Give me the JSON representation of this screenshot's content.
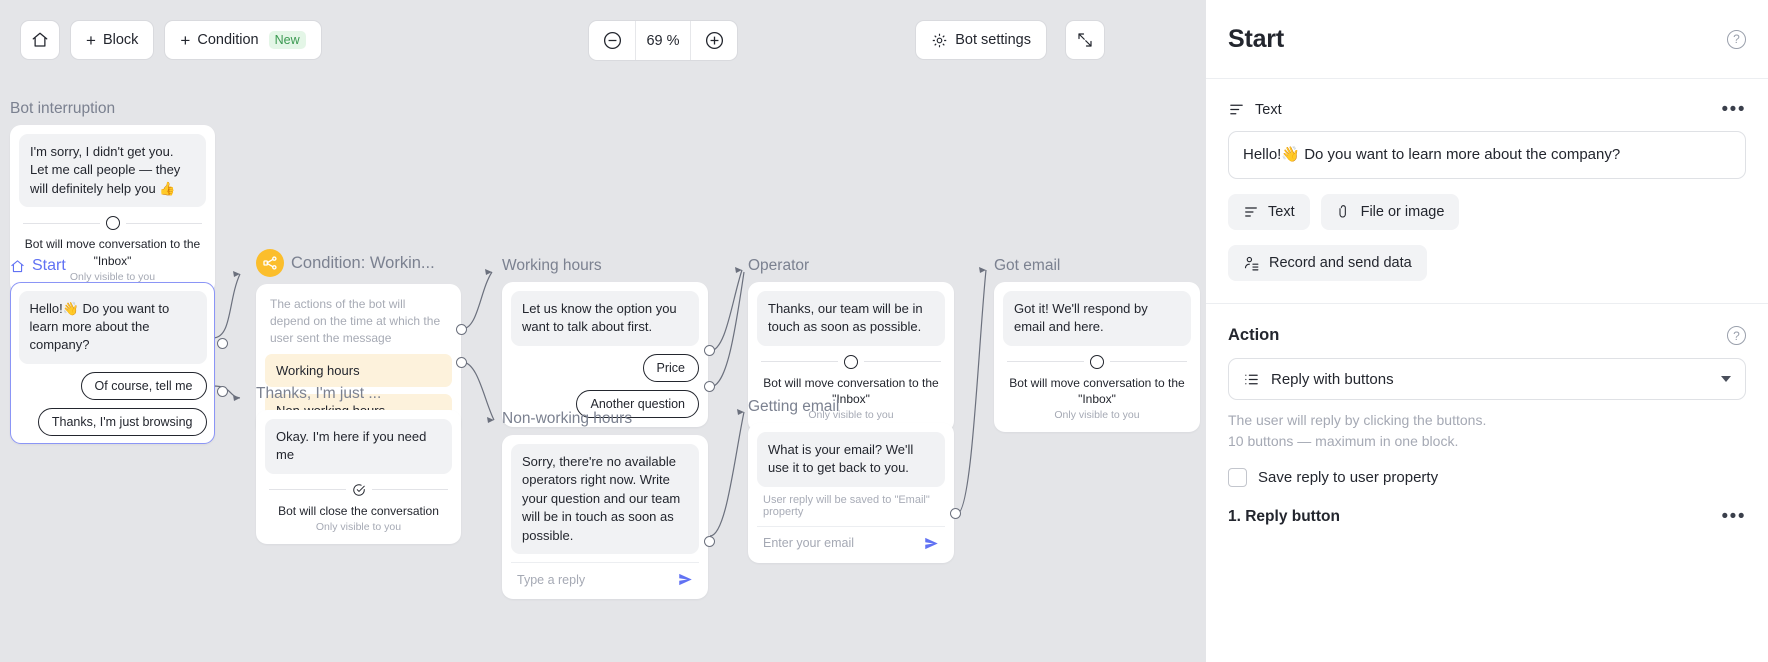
{
  "toolbar": {
    "home_label": "",
    "block_label": "Block",
    "condition_label": "Condition",
    "condition_badge": "New",
    "zoom_value": "69 %",
    "zoom_out_label": "",
    "zoom_in_label": "",
    "bot_settings_label": "Bot settings",
    "expand_label": ""
  },
  "canvas": {
    "nodes": [
      {
        "id": "bot-interruption",
        "title": "Bot interruption",
        "message": "I'm sorry, I didn't get you. Let me call people — they will definitely help you 👍",
        "note_main": "Bot will move conversation to the \"Inbox\"",
        "note_sub": "Only visible to you"
      },
      {
        "id": "start",
        "title": "Start",
        "message": "Hello!👋 Do you want to learn more about the company?",
        "buttons": [
          "Of course, tell me",
          "Thanks, I'm just browsing"
        ]
      },
      {
        "id": "condition-working",
        "title": "Condition: Workin...",
        "description": "The actions of the bot will depend on the time at which the user sent the message",
        "branches": [
          "Working hours",
          "Non-working hours"
        ]
      },
      {
        "id": "thanks-im-just",
        "title": "Thanks, I'm just ...",
        "message": "Okay. I'm here if you need me",
        "note_main": "Bot will close the conversation",
        "note_sub": "Only visible to you"
      },
      {
        "id": "working-hours",
        "title": "Working hours",
        "message": "Let us know the option you want to talk about first.",
        "buttons": [
          "Price",
          "Another question"
        ]
      },
      {
        "id": "non-working-hours",
        "title": "Non-working hours",
        "message": "Sorry, there're no available operators right now. Write your question and our team will be in touch as soon as possible.",
        "input_placeholder": "Type a reply"
      },
      {
        "id": "operator",
        "title": "Operator",
        "message": "Thanks, our team will be in touch as soon as possible.",
        "note_main": "Bot will move conversation to the \"Inbox\"",
        "note_sub": "Only visible to you"
      },
      {
        "id": "getting-email",
        "title": "Getting email",
        "message": "What is your email? We'll use it to get back to you.",
        "property_note": "User reply will be saved to \"Email\" property",
        "input_placeholder": "Enter your email"
      },
      {
        "id": "got-email",
        "title": "Got email",
        "message": "Got it! We'll respond by email and here.",
        "note_main": "Bot will move conversation to the \"Inbox\"",
        "note_sub": "Only visible to you"
      }
    ]
  },
  "panel": {
    "title": "Start",
    "help_label": "?",
    "text_section": {
      "label": "Text",
      "menu_label": "•••",
      "value": "Hello!👋 Do you want to learn more about the company?"
    },
    "add_buttons": [
      {
        "label": "Text",
        "icon": "text-lines-icon"
      },
      {
        "label": "File or image",
        "icon": "paperclip-icon"
      },
      {
        "label": "Record and send data",
        "icon": "record-data-icon"
      }
    ],
    "action_section": {
      "heading": "Action",
      "help_label": "?",
      "select_value": "Reply with buttons",
      "hint_line1": "The user will reply by clicking the buttons.",
      "hint_line2": "10 buttons — maximum in one block.",
      "checkbox_label": "Save reply to user property",
      "reply_button_heading": "1. Reply button",
      "reply_button_menu": "•••"
    }
  },
  "colors": {
    "accent": "#6172f3",
    "condition": "#fbbe2c",
    "branch_bg": "#fdf2dc",
    "new_badge": "#3c9a52",
    "canvas_bg": "#e4e5e8"
  }
}
